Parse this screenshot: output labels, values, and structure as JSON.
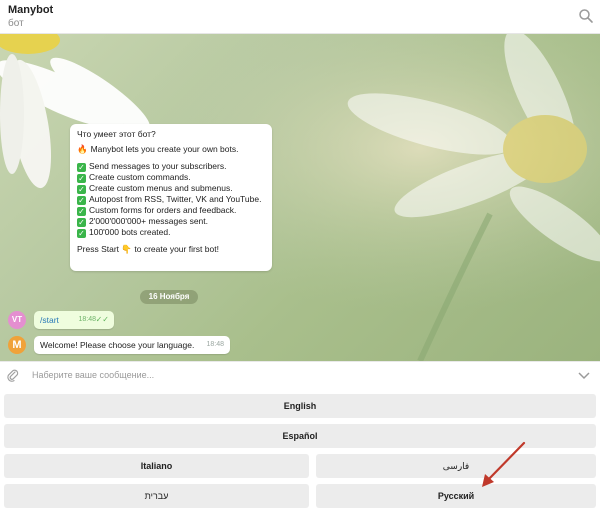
{
  "header": {
    "title": "Manybot",
    "subtitle": "бот"
  },
  "card": {
    "title": "Что умеет этот бот?",
    "intro": "Manybot lets you create your own bots.",
    "features": [
      "Send messages to your subscribers.",
      "Create custom commands.",
      "Create custom menus and submenus.",
      "Autopost from RSS, Twitter, VK and YouTube.",
      "Custom forms for orders and feedback.",
      "2'000'000'000+ messages sent.",
      "100'000 bots created."
    ],
    "cta_before": "Press Start",
    "cta_after": "to create your first bot!"
  },
  "date_pill": "16 Ноября",
  "messages": {
    "user_avatar": "VT",
    "bot_avatar": "M",
    "user_text": "/start",
    "user_time": "18:48",
    "bot_text": "Welcome! Please choose your language.",
    "bot_time": "18:48"
  },
  "input": {
    "placeholder": "Наберите ваше сообщение..."
  },
  "keyboard": {
    "english": "English",
    "espanol": "Español",
    "italiano": "Italiano",
    "farsi": "فارسی",
    "hebrew": "עברית",
    "russian": "Русский"
  },
  "colors": {
    "accent_green": "#3ab54a",
    "annotation_arrow": "#c0392b",
    "outgoing_bubble": "#effdde"
  },
  "icons": [
    "search-icon",
    "paperclip-icon",
    "chevron-down-icon",
    "fire-icon",
    "check-icon",
    "pointing-hand-icon"
  ]
}
